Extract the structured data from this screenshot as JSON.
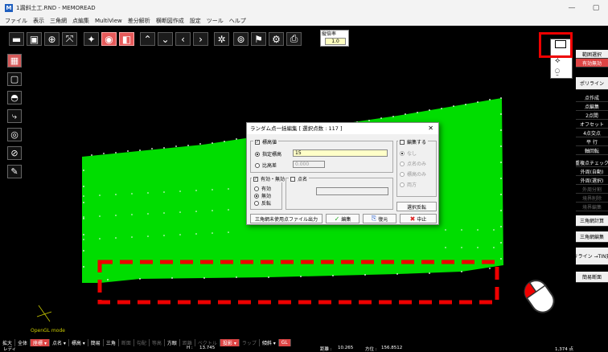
{
  "window": {
    "title": "1漏斜土工.RND - MEMOREAD",
    "app_icon": "M",
    "min": "—",
    "max": "▢"
  },
  "menu": [
    "ファイル",
    "表示",
    "三角網",
    "点編集",
    "MultiView",
    "差分解析",
    "横断図作成",
    "設定",
    "ツール",
    "ヘルプ"
  ],
  "scale": {
    "label": "縦倍率",
    "value": "1.0"
  },
  "dialog": {
    "title": "ランダム点一括編集 [ 選択点数 : 117 ]",
    "close": "✕",
    "elevation_group": "標高値",
    "specify_elevation": "指定標高",
    "specify_value": "15",
    "relative_height": "比高差",
    "relative_value": "0.000",
    "edit_group": "編集する",
    "edit_none": "なし",
    "edit_name_only": "点名のみ",
    "edit_elev_only": "標高のみ",
    "edit_both": "両方",
    "valid_group": "有効・無効",
    "valid": "有効",
    "invalid": "無効",
    "invert": "反転",
    "name_group": "点名",
    "select_invert": "選択反転",
    "triangle_output": "三角網未使用点ファイル出力",
    "edit_btn": "編集",
    "restore_btn": "復元",
    "cancel_btn": "中止"
  },
  "right_panel": [
    "範囲選択",
    "有効無効",
    "",
    "ポリライン",
    "点作成",
    "点編集",
    "2点間",
    "オフセット",
    "4点交点",
    "平 行",
    "軸回転",
    "重複点チェック",
    "外周(自動)",
    "外周(選択)",
    "外周分割",
    "境界削除",
    "境界編集",
    "",
    "三角網計算",
    "",
    "三角網編集",
    "",
    "ポリライン →TIN変換",
    "",
    "簡易断面"
  ],
  "status1": [
    "拡大",
    "全体",
    "座標 ▾",
    "点名 ▾",
    "標高 ▾",
    "簡易",
    "三角",
    "断面",
    "勾配",
    "等高",
    "方眼",
    "距離",
    "ベクトル",
    "投影 ▾",
    "ラップ",
    "傾斜 ▾",
    "GL"
  ],
  "status2": {
    "mode": "レディ",
    "h_label": "H :",
    "h_value": "13.745",
    "dist_label": "距離 :",
    "dist_value": "10.265",
    "dir_label": "方位 :",
    "dir_value": "156.8512",
    "count": "1,374 点"
  },
  "canvas": {
    "mode_label": "OpenGL mode"
  },
  "colors": {
    "terrain": "#00dd00",
    "highlight": "#ee0000"
  }
}
